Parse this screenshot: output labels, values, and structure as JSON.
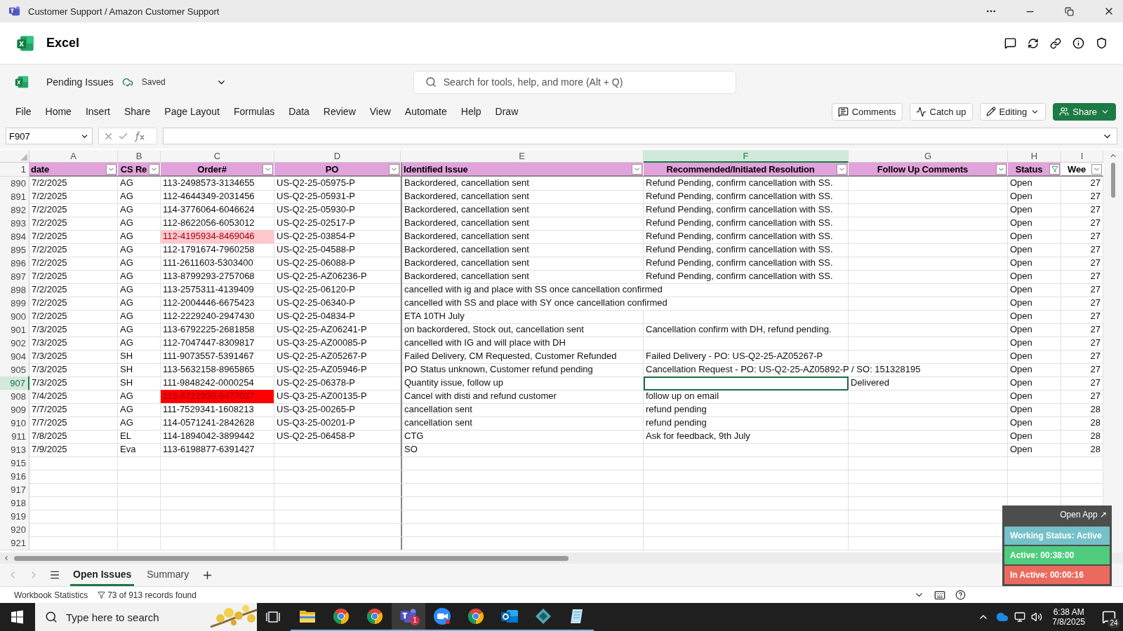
{
  "window": {
    "title": "Customer Support / Amazon Customer Support"
  },
  "app": {
    "name": "Excel"
  },
  "document": {
    "name": "Pending Issues",
    "save_state": "Saved"
  },
  "search": {
    "placeholder": "Search for tools, help, and more (Alt + Q)"
  },
  "menu": [
    "File",
    "Home",
    "Insert",
    "Share",
    "Page Layout",
    "Formulas",
    "Data",
    "Review",
    "View",
    "Automate",
    "Help",
    "Draw"
  ],
  "actions": [
    {
      "kind": "comments",
      "label": "Comments"
    },
    {
      "kind": "catchup",
      "label": "Catch up"
    },
    {
      "kind": "editing",
      "label": "Editing"
    },
    {
      "kind": "share",
      "label": "Share"
    }
  ],
  "formula_bar": {
    "name_box": "F907"
  },
  "columns": [
    {
      "letter": "A",
      "selected": false
    },
    {
      "letter": "B",
      "selected": false
    },
    {
      "letter": "C",
      "selected": false
    },
    {
      "letter": "D",
      "selected": false
    },
    {
      "letter": "E",
      "selected": false
    },
    {
      "letter": "F",
      "selected": true
    },
    {
      "letter": "G",
      "selected": false
    },
    {
      "letter": "H",
      "selected": false
    },
    {
      "letter": "I",
      "selected": false
    }
  ],
  "header_row": "1",
  "headers": [
    {
      "label": "date",
      "filter_active": false
    },
    {
      "label": "CS Re",
      "filter_active": false
    },
    {
      "label": "Order#",
      "filter_active": false
    },
    {
      "label": "PO",
      "filter_active": false
    },
    {
      "label": "Identified Issue",
      "filter_active": false
    },
    {
      "label": "Recommended/Initiated Resolution",
      "filter_active": false
    },
    {
      "label": "Follow Up Comments",
      "filter_active": false
    },
    {
      "label": "Status",
      "filter_active": true
    },
    {
      "label": "Wee",
      "filter_active": false
    }
  ],
  "rows": [
    {
      "num": "890",
      "date": "7/2/2025",
      "rep": "AG",
      "order": "113-2498573-3134655",
      "po": "US-Q2-25-05975-P",
      "issue": "Backordered, cancellation sent",
      "resolution": "Refund Pending, confirm cancellation with SS.",
      "status": "Open",
      "week": "27",
      "selected": false
    },
    {
      "num": "891",
      "date": "7/2/2025",
      "rep": "AG",
      "order": "112-4644349-2031456",
      "po": "US-Q2-25-05931-P",
      "issue": "Backordered, cancellation sent",
      "resolution": "Refund Pending, confirm cancellation with SS.",
      "status": "Open",
      "week": "27",
      "selected": false
    },
    {
      "num": "892",
      "date": "7/2/2025",
      "rep": "AG",
      "order": "114-3776064-6046624",
      "po": "US-Q2-25-05930-P",
      "issue": "Backordered, cancellation sent",
      "resolution": "Refund Pending, confirm cancellation with SS.",
      "status": "Open",
      "week": "27",
      "selected": false
    },
    {
      "num": "893",
      "date": "7/2/2025",
      "rep": "AG",
      "order": "112-8622056-6053012",
      "po": "US-Q2-25-02517-P",
      "issue": "Backordered, cancellation sent",
      "resolution": "Refund Pending, confirm cancellation with SS.",
      "status": "Open",
      "week": "27",
      "selected": false
    },
    {
      "num": "894",
      "date": "7/2/2025",
      "rep": "AG",
      "order": "112-4195934-8469046",
      "color": "#ffc7ce",
      "po": "US-Q2-25-03854-P",
      "issue": "Backordered, cancellation sent",
      "resolution": "Refund Pending, confirm cancellation with SS.",
      "status": "Open",
      "week": "27",
      "selected": false
    },
    {
      "num": "895",
      "date": "7/2/2025",
      "rep": "AG",
      "order": "112-1791674-7960258",
      "po": "US-Q2-25-04588-P",
      "issue": "Backordered, cancellation sent",
      "resolution": "Refund Pending, confirm cancellation with SS.",
      "status": "Open",
      "week": "27",
      "selected": false
    },
    {
      "num": "896",
      "date": "7/2/2025",
      "rep": "AG",
      "order": "111-2611603-5303400",
      "po": "US-Q2-25-06088-P",
      "issue": "Backordered, cancellation sent",
      "resolution": "Refund Pending, confirm cancellation with SS.",
      "status": "Open",
      "week": "27",
      "selected": false
    },
    {
      "num": "897",
      "date": "7/2/2025",
      "rep": "AG",
      "order": "113-8799293-2757068",
      "po": "US-Q2-25-AZ06236-P",
      "issue": "Backordered, cancellation sent",
      "resolution": "Refund Pending, confirm cancellation with SS.",
      "status": "Open",
      "week": "27",
      "selected": false
    },
    {
      "num": "898",
      "date": "7/2/2025",
      "rep": "AG",
      "order": "113-2575311-4139409",
      "po": "US-Q2-25-06120-P",
      "issue": "cancelled with ig and place with SS once cancellation confirmed",
      "status": "Open",
      "week": "27",
      "selected": false
    },
    {
      "num": "899",
      "date": "7/2/2025",
      "rep": "AG",
      "order": "112-2004446-6675423",
      "po": "US-Q2-25-06340-P",
      "issue": "cancelled with SS and place with SY once cancellation confirmed",
      "status": "Open",
      "week": "27",
      "selected": false
    },
    {
      "num": "900",
      "date": "7/2/2025",
      "rep": "AG",
      "order": "112-2229240-2947430",
      "po": "US-Q2-25-04834-P",
      "issue": "ETA 10TH July",
      "status": "Open",
      "week": "27",
      "selected": false
    },
    {
      "num": "901",
      "date": "7/3/2025",
      "rep": "AG",
      "order": "113-6792225-2681858",
      "po": "US-Q2-25-AZ06241-P",
      "issue": "on backordered, Stock out, cancellation sent",
      "resolution": "Cancellation confirm with DH, refund pending.",
      "status": "Open",
      "week": "27",
      "selected": false
    },
    {
      "num": "902",
      "date": "7/3/2025",
      "rep": "AG",
      "order": "112-7047447-8309817",
      "po": "US-Q3-25-AZ00085-P",
      "issue": "cancelled with IG and will place with DH",
      "status": "Open",
      "week": "27",
      "selected": false
    },
    {
      "num": "904",
      "date": "7/3/2025",
      "rep": "SH",
      "order": "111-9073557-5391467",
      "po": "US-Q2-25-AZ05267-P",
      "issue": "Failed Delivery, CM Requested, Customer Refunded",
      "resolution": "Failed Delivery - PO: US-Q2-25-AZ05267-P",
      "status": "Open",
      "week": "27",
      "selected": false
    },
    {
      "num": "905",
      "date": "7/3/2025",
      "rep": "SH",
      "order": "113-5632158-8965865",
      "po": "US-Q2-25-AZ05946-P",
      "issue": "PO Status unknown, Customer refund pending",
      "resolution": "Cancellation Request - PO: US-Q2-25-AZ05892-P / SO: 151328195",
      "status": "Open",
      "week": "27",
      "selected": false
    },
    {
      "num": "907",
      "date": "7/3/2025",
      "rep": "SH",
      "order": "111-9848242-0000254",
      "po": "US-Q2-25-06378-P",
      "issue": "Quantity issue, follow up",
      "follow_up": "Delivered",
      "status": "Open",
      "week": "27",
      "selected": true
    },
    {
      "num": "908",
      "date": "7/4/2025",
      "rep": "AG",
      "order": "113-8721930-9477037",
      "color": "#ff0000",
      "po": "US-Q3-25-AZ00135-P",
      "issue": "Cancel with disti and refund customer",
      "resolution": "follow up on email",
      "status": "Open",
      "week": "27",
      "selected": false
    },
    {
      "num": "909",
      "date": "7/7/2025",
      "rep": "AG",
      "order": "111-7529341-1608213",
      "po": "US-Q3-25-00265-P",
      "issue": "cancellation sent",
      "resolution": "refund pending",
      "status": "Open",
      "week": "28",
      "selected": false
    },
    {
      "num": "910",
      "date": "7/7/2025",
      "rep": "AG",
      "order": "114-0571241-2842628",
      "po": "US-Q3-25-00201-P",
      "issue": "cancellation sent",
      "resolution": "refund pending",
      "status": "Open",
      "week": "28",
      "selected": false
    },
    {
      "num": "911",
      "date": "7/8/2025",
      "rep": "EL",
      "order": "114-1894042-3899442",
      "po": "US-Q2-25-06458-P",
      "issue": "CTG",
      "resolution": "Ask for feedback, 9th July",
      "status": "Open",
      "week": "28",
      "selected": false
    },
    {
      "num": "913",
      "date": "7/9/2025",
      "rep": "Eva",
      "order": "113-6198877-6391427",
      "issue": "SO",
      "status": "Open",
      "week": "28",
      "selected": false
    }
  ],
  "empty_rows": [
    "915",
    "916",
    "917",
    "918",
    "919",
    "920",
    "921"
  ],
  "sheet_tabs": [
    {
      "label": "Open Issues",
      "selected": true
    },
    {
      "label": "Summary",
      "selected": false
    }
  ],
  "status_bar": {
    "stats": "Workbook Statistics",
    "records": "73 of 913 records found"
  },
  "tracker": {
    "link": "Open App ↗",
    "status": "Working Status: Active",
    "active": "Active: 00:38:00",
    "inactive": "In Active: 00:00:16"
  },
  "taskbar": {
    "search_placeholder": "Type here to search",
    "apps": [
      {
        "kind": "folder",
        "selected": false
      },
      {
        "kind": "chrome",
        "selected": false
      },
      {
        "kind": "chrome",
        "selected": false
      },
      {
        "kind": "teams",
        "selected": true,
        "badge": "1"
      },
      {
        "kind": "zoom",
        "selected": false
      },
      {
        "kind": "chrome",
        "selected": false
      },
      {
        "kind": "outlook",
        "selected": false
      },
      {
        "kind": "diamond",
        "selected": false
      },
      {
        "kind": "notepad",
        "selected": false
      }
    ],
    "time": "6:38 AM",
    "date": "7/8/2025",
    "notifications": "24"
  }
}
